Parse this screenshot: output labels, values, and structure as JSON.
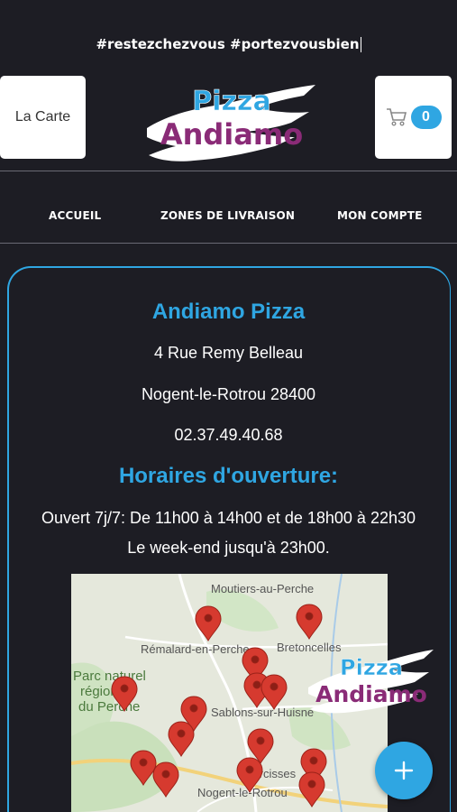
{
  "promo": {
    "hashtags": "#restezchezvous #portezvousbien"
  },
  "header": {
    "menu_label": "La Carte",
    "cart_count": "0",
    "logo": {
      "line1": "Pizza",
      "line2": "Andiamo"
    }
  },
  "nav": {
    "items": [
      "ACCUEIL",
      "ZONES DE LIVRAISON",
      "MON COMPTE"
    ]
  },
  "restaurant": {
    "name": "Andiamo Pizza",
    "street": "4 Rue Remy Belleau",
    "city": "Nogent-le-Rotrou 28400",
    "phone": "02.37.49.40.68"
  },
  "hours": {
    "title": "Horaires d'ouverture:",
    "line1": "Ouvert 7j/7: De 11h00 à 14h00 et de 18h00 à 22h30",
    "line2": "Le week-end jusqu'à 23h00."
  },
  "map": {
    "places": {
      "moutiers": "Moutiers-au-Perche",
      "remalard": "Rémalard-en-Perche",
      "bretoncelles": "Bretoncelles",
      "parc1": "Parc naturel",
      "parc2": "régional",
      "parc3": "du Perche",
      "sablons": "Sablons-sur-Huisne",
      "arcisses": "Arcisses",
      "nogent": "Nogent-le-Rotrou"
    }
  },
  "float_logo": {
    "line1": "Pizza",
    "line2": "Andiamo"
  },
  "colors": {
    "accent": "#2fa6e2",
    "background": "#1d1d24",
    "logo_purple": "#8a2b77",
    "pin_red": "#d63a2f"
  },
  "icons": {
    "cart": "cart-icon",
    "add": "plus-icon",
    "pin": "map-pin-icon"
  }
}
